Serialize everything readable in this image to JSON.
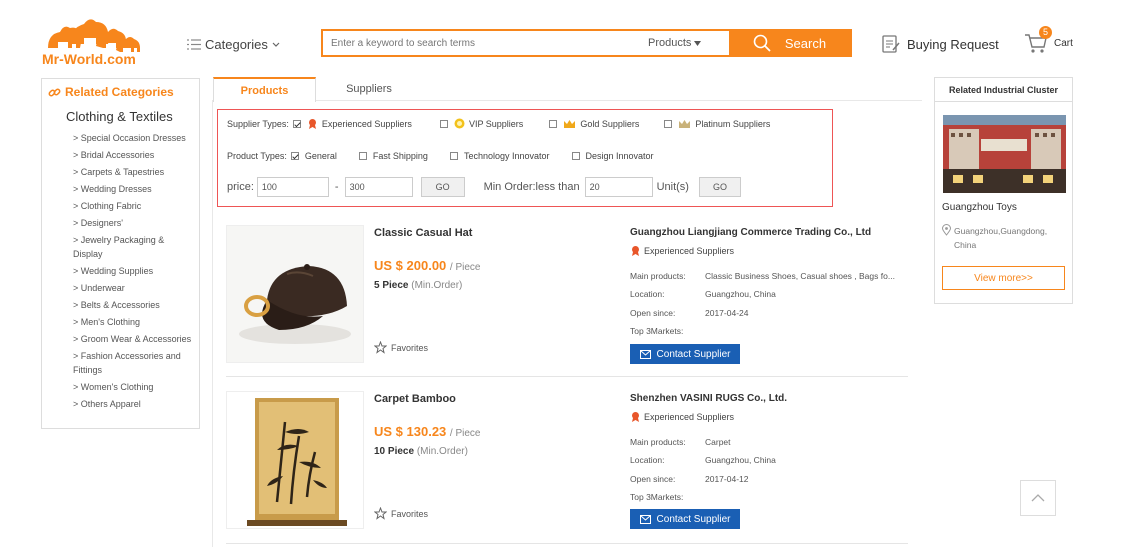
{
  "header": {
    "logo_text": "Mr-World.com",
    "categories_label": "Categories",
    "search_placeholder": "Enter a keyword to search terms",
    "search_type": "Products",
    "search_button": "Search",
    "buying_request": "Buying Request",
    "cart_label": "Cart",
    "cart_count": "5"
  },
  "sidebar": {
    "title": "Related Categories",
    "category": "Clothing & Textiles",
    "items": [
      "> Special Occasion Dresses",
      "> Bridal Accessories",
      "> Carpets & Tapestries",
      "> Wedding Dresses",
      "> Clothing Fabric",
      "> Designers'",
      "> Jewelry Packaging & Display",
      "> Wedding Supplies",
      "> Underwear",
      "> Belts & Accessories",
      "> Men's Clothing",
      "> Groom Wear & Accessories",
      "> Fashion Accessories and Fittings",
      "> Women's Clothing",
      "> Others Apparel"
    ]
  },
  "tabs": {
    "products": "Products",
    "suppliers": "Suppliers"
  },
  "filters": {
    "supplier_types_label": "Supplier Types:",
    "supplier_types": [
      "Experienced Suppliers",
      "VIP Suppliers",
      "Gold Suppliers",
      "Platinum Suppliers"
    ],
    "product_types_label": "Product Types:",
    "product_types": [
      "General",
      "Fast Shipping",
      "Technology Innovator",
      "Design Innovator"
    ],
    "price_label": "price:",
    "price_min": "100",
    "price_sep": "-",
    "price_max": "300",
    "go": "GO",
    "min_order_label": "Min Order:less than",
    "min_order_value": "20",
    "unit_label": "Unit(s)"
  },
  "products": [
    {
      "name": "Classic Casual Hat",
      "price": "US $ 200.00",
      "price_unit": "/ Piece",
      "min_qty": "5 Piece",
      "min_label": "(Min.Order)",
      "favorites": "Favorites",
      "supplier": "Guangzhou Liangjiang Commerce Trading Co., Ltd",
      "supplier_type": "Experienced Suppliers",
      "main_products_label": "Main products:",
      "main_products": "Classic Business Shoes, Casual shoes , Bags fo...",
      "location_label": "Location:",
      "location": "Guangzhou, China",
      "open_label": "Open since:",
      "open_since": "2017-04-24",
      "markets_label": "Top 3Markets:",
      "contact": "Contact Supplier"
    },
    {
      "name": "Carpet Bamboo",
      "price": "US $ 130.23",
      "price_unit": "/ Piece",
      "min_qty": "10 Piece",
      "min_label": "(Min.Order)",
      "favorites": "Favorites",
      "supplier": "Shenzhen VASINI RUGS Co., Ltd.",
      "supplier_type": "Experienced Suppliers",
      "main_products_label": "Main products:",
      "main_products": "Carpet",
      "location_label": "Location:",
      "location": "Guangzhou, China",
      "open_label": "Open since:",
      "open_since": "2017-04-12",
      "markets_label": "Top 3Markets:",
      "contact": "Contact Supplier"
    }
  ],
  "cluster": {
    "title": "Related Industrial Cluster",
    "name": "Guangzhou Toys",
    "location": "Guangzhou,Guangdong, China",
    "view_more": "View more>>"
  },
  "colors": {
    "accent": "#f7861c",
    "contact": "#1a5fb4",
    "filter_border": "#e55"
  }
}
